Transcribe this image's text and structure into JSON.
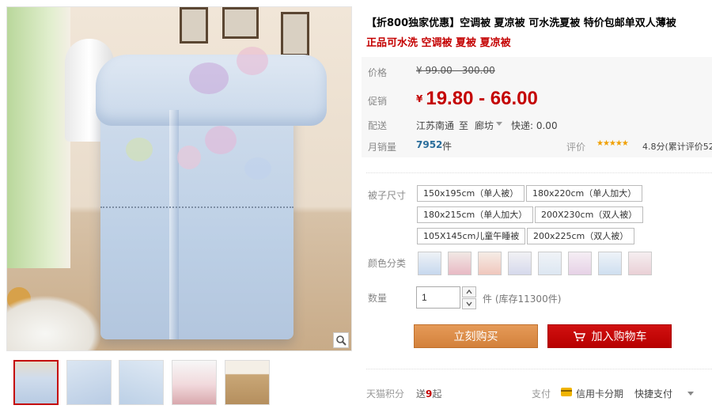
{
  "product": {
    "title": "【折800独家优惠】空调被 夏凉被 可水洗夏被 特价包邮单双人薄被",
    "subtitle": "正品可水洗 空调被 夏被 夏凉被"
  },
  "price": {
    "original_label": "价格",
    "original_value": "¥ 99.00 - 300.00",
    "promo_label": "促销",
    "currency": "¥",
    "promo_value": "19.80 - 66.00"
  },
  "shipping": {
    "label": "配送",
    "from": "江苏南通",
    "to_word": "至",
    "destination": "廊坊",
    "express": "快递: 0.00"
  },
  "sales": {
    "label": "月销量",
    "count": "7952",
    "unit": "件",
    "rating_label": "评价",
    "stars": "★★★★★",
    "rating_text": "4.8分(累计评价52"
  },
  "size": {
    "label": "被子尺寸",
    "options": [
      "150x195cm（单人被）",
      "180x220cm（单人加大）",
      "180x215cm（单人加大）",
      "200X230cm（双人被）",
      "105X145cm儿童午睡被",
      "200x225cm（双人被）"
    ]
  },
  "color": {
    "label": "颜色分类",
    "swatch_colors": [
      "#c7d8ee",
      "#e8b9c4",
      "#f0c7bd",
      "#d6d9ec",
      "#dde7f2",
      "#e6d2e6",
      "#cfdff0",
      "#ead0d6"
    ]
  },
  "quantity": {
    "label": "数量",
    "value": "1",
    "unit": "件",
    "stock": "(库存11300件)"
  },
  "actions": {
    "buy_now": "立刻购买",
    "add_to_cart": "加入购物车"
  },
  "bottom": {
    "points_label": "天猫积分",
    "points_prefix": "送",
    "points_value": "9",
    "points_suffix": "起",
    "pay_label": "支付",
    "card_installment": "信用卡分期",
    "quick_pay": "快捷支付"
  },
  "gallery": {
    "thumbs": [
      "#cfdcec",
      "#c6d6ea",
      "#d3dfee",
      "#f1d9dc",
      "#c9a777"
    ],
    "icons": [
      "zoom-icon",
      "cart-icon",
      "credit-card-icon"
    ]
  },
  "colors": {
    "accent_red": "#c40000",
    "buy_orange": "#d3813c",
    "sales_blue": "#2a6d9b"
  }
}
